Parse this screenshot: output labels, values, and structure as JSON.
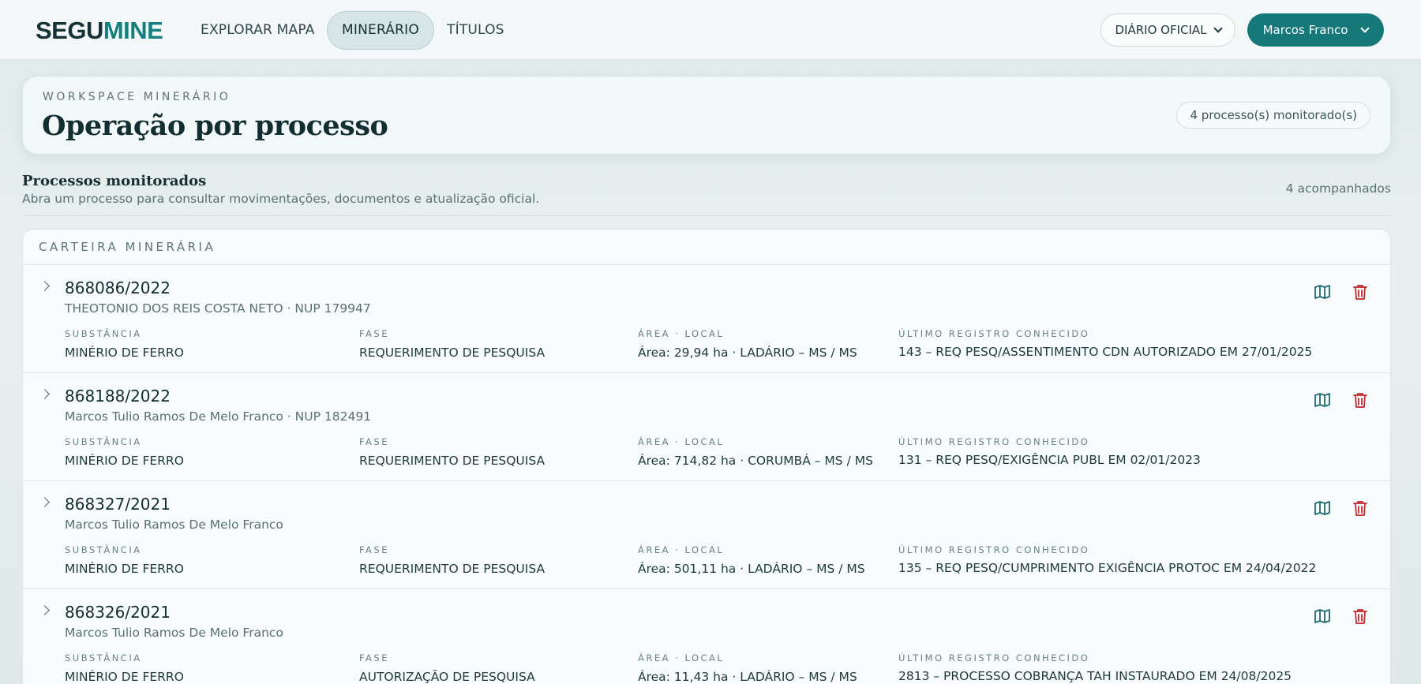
{
  "app": {
    "logo_part1": "SEGU",
    "logo_part2": "MINE"
  },
  "nav": {
    "items": [
      {
        "label": "EXPLORAR MAPA"
      },
      {
        "label": "MINERÁRIO",
        "active": true
      },
      {
        "label": "TÍTULOS"
      }
    ],
    "diario_label": "DIÁRIO OFICIAL",
    "user_label": "Marcos Franco"
  },
  "workspace": {
    "kicker": "WORKSPACE MINERÁRIO",
    "title": "Operação por processo",
    "badge": "4 processo(s) monitorado(s)"
  },
  "section": {
    "title": "Processos monitorados",
    "subtitle": "Abra um processo para consultar movimentações, documentos e atualização oficial.",
    "count": "4 acompanhados"
  },
  "portfolio": {
    "header": "CARTEIRA MINERÁRIA",
    "labels": {
      "substance": "SUBSTÂNCIA",
      "phase": "FASE",
      "area": "ÁREA · LOCAL",
      "last": "ÚLTIMO REGISTRO CONHECIDO"
    },
    "rows": [
      {
        "process": "868086/2022",
        "holder": "THEOTONIO DOS REIS COSTA NETO · NUP 179947",
        "substance": "MINÉRIO DE FERRO",
        "phase": "REQUERIMENTO DE PESQUISA",
        "area": "Área: 29,94 ha · LADÁRIO – MS / MS",
        "last": "143 – REQ PESQ/ASSENTIMENTO CDN AUTORIZADO EM 27/01/2025"
      },
      {
        "process": "868188/2022",
        "holder": "Marcos Tulio Ramos De Melo Franco · NUP 182491",
        "substance": "MINÉRIO DE FERRO",
        "phase": "REQUERIMENTO DE PESQUISA",
        "area": "Área: 714,82 ha · CORUMBÁ – MS / MS",
        "last": "131 – REQ PESQ/EXIGÊNCIA PUBL EM 02/01/2023"
      },
      {
        "process": "868327/2021",
        "holder": "Marcos Tulio Ramos De Melo Franco",
        "substance": "MINÉRIO DE FERRO",
        "phase": "REQUERIMENTO DE PESQUISA",
        "area": "Área: 501,11 ha · LADÁRIO – MS / MS",
        "last": "135 – REQ PESQ/CUMPRIMENTO EXIGÊNCIA PROTOC EM 24/04/2022"
      },
      {
        "process": "868326/2021",
        "holder": "Marcos Tulio Ramos De Melo Franco",
        "substance": "MINÉRIO DE FERRO",
        "phase": "AUTORIZAÇÃO DE PESQUISA",
        "area": "Área: 11,43 ha · LADÁRIO – MS / MS",
        "last": "2813 – PROCESSO COBRANÇA TAH INSTAURADO EM 24/08/2025"
      }
    ]
  },
  "icons": {
    "map": "map-icon",
    "delete": "trash-icon",
    "expand": "chevron-right-icon",
    "dropdown": "chevron-down-icon"
  },
  "colors": {
    "brand": "#17787a",
    "logo_accent": "#15807f",
    "danger": "#c0262d"
  }
}
